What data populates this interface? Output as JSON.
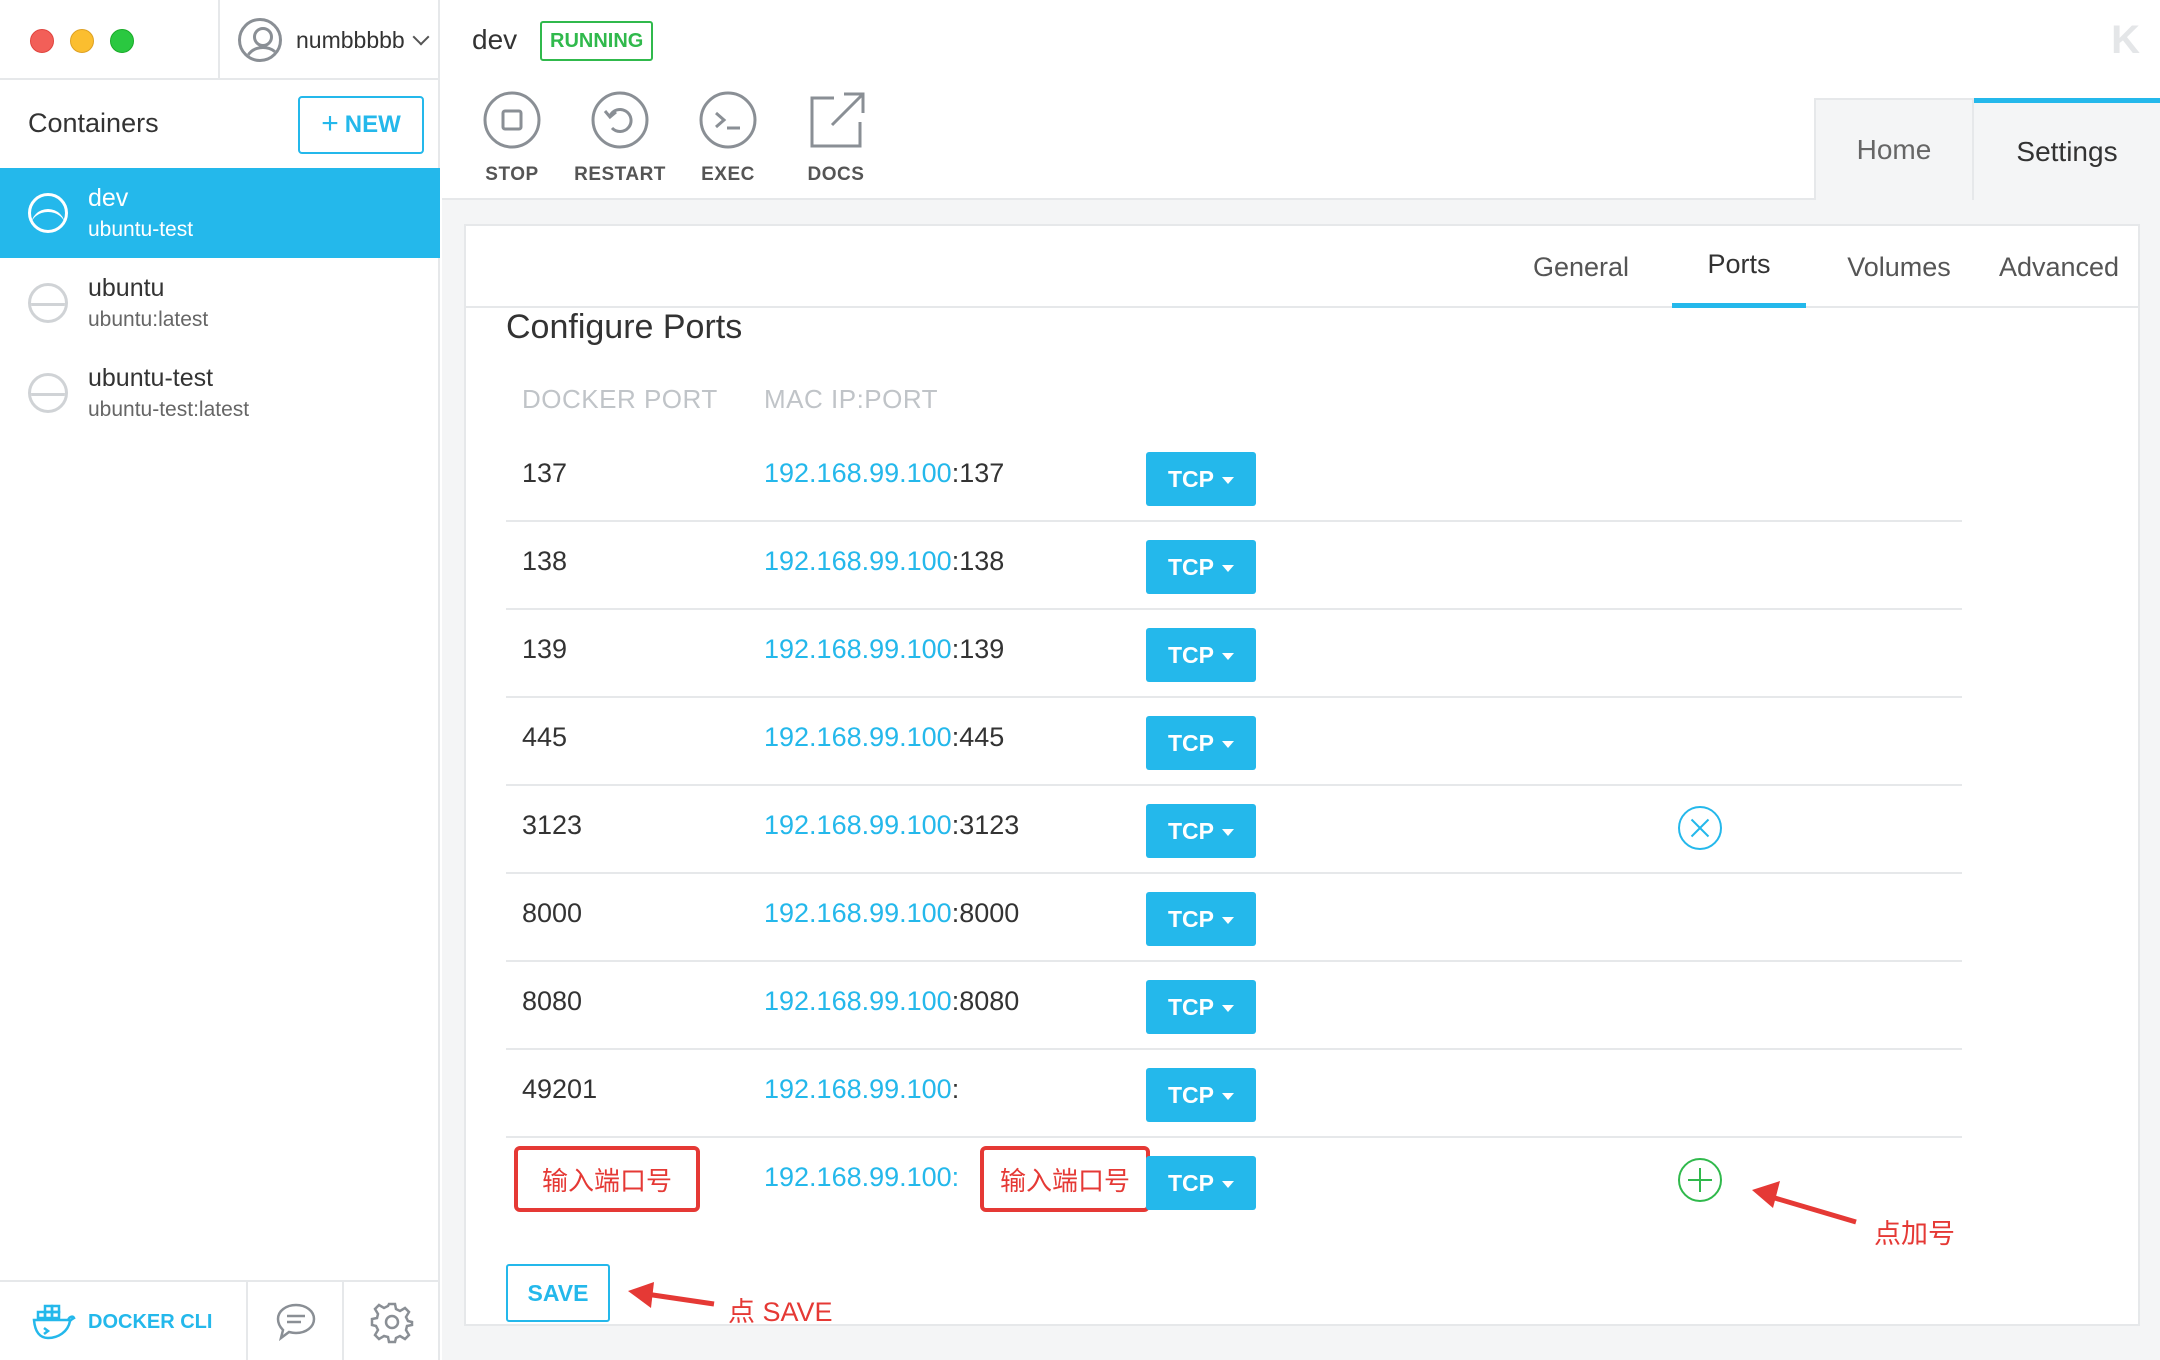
{
  "window": {
    "user": "numbbbbb",
    "sidebar_title": "Containers",
    "new_button": "NEW"
  },
  "containers": [
    {
      "name": "dev",
      "image": "ubuntu-test",
      "active": true
    },
    {
      "name": "ubuntu",
      "image": "ubuntu:latest",
      "active": false
    },
    {
      "name": "ubuntu-test",
      "image": "ubuntu-test:latest",
      "active": false
    }
  ],
  "footer": {
    "docker_cli": "DOCKER CLI"
  },
  "header": {
    "title": "dev",
    "status": "RUNNING",
    "actions": [
      {
        "label": "STOP",
        "icon": "stop-icon"
      },
      {
        "label": "RESTART",
        "icon": "restart-icon"
      },
      {
        "label": "EXEC",
        "icon": "terminal-icon"
      },
      {
        "label": "DOCS",
        "icon": "external-link-icon"
      }
    ],
    "tabs": {
      "home": "Home",
      "settings": "Settings"
    }
  },
  "subtabs": {
    "general": "General",
    "ports": "Ports",
    "volumes": "Volumes",
    "advanced": "Advanced"
  },
  "ports": {
    "title": "Configure Ports",
    "col_docker": "DOCKER PORT",
    "col_mac": "MAC IP:PORT",
    "ip": "192.168.99.100",
    "rows": [
      {
        "docker": "137",
        "host": ":137",
        "proto": "TCP"
      },
      {
        "docker": "138",
        "host": ":138",
        "proto": "TCP"
      },
      {
        "docker": "139",
        "host": ":139",
        "proto": "TCP"
      },
      {
        "docker": "445",
        "host": ":445",
        "proto": "TCP"
      },
      {
        "docker": "3123",
        "host": ":3123",
        "proto": "TCP"
      },
      {
        "docker": "8000",
        "host": ":8000",
        "proto": "TCP"
      },
      {
        "docker": "8080",
        "host": ":8080",
        "proto": "TCP"
      },
      {
        "docker": "49201",
        "host": ":",
        "proto": "TCP"
      }
    ],
    "new_row": {
      "docker_placeholder": "输入端口号",
      "ip": "192.168.99.100:",
      "host_placeholder": "输入端口号",
      "proto": "TCP"
    },
    "save": "SAVE"
  },
  "annotations": {
    "add": "点加号",
    "save": "点 SAVE"
  },
  "colors": {
    "accent": "#24b8eb",
    "running": "#30b94c",
    "annotation": "#e53935"
  }
}
